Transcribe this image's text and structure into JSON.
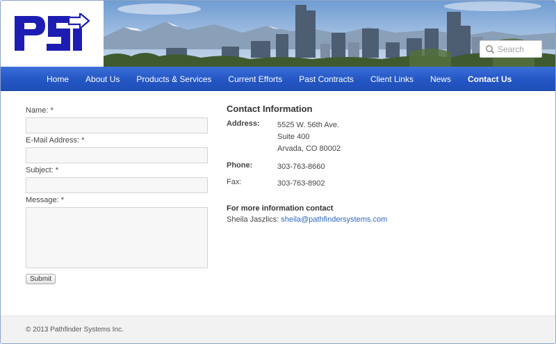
{
  "logo": {
    "text": "PSI",
    "color": "#1d1db3"
  },
  "search": {
    "placeholder": "Search",
    "icon": "search-icon"
  },
  "nav": {
    "items": [
      {
        "label": "Home",
        "active": false
      },
      {
        "label": "About Us",
        "active": false
      },
      {
        "label": "Products & Services",
        "active": false
      },
      {
        "label": "Current Efforts",
        "active": false
      },
      {
        "label": "Past Contracts",
        "active": false
      },
      {
        "label": "Client Links",
        "active": false
      },
      {
        "label": "News",
        "active": false
      },
      {
        "label": "Contact Us",
        "active": true
      }
    ],
    "color": "#2456c4"
  },
  "form": {
    "name_label": "Name: *",
    "email_label": "E-Mail Address: *",
    "subject_label": "Subject: *",
    "message_label": "Message: *",
    "name_value": "",
    "email_value": "",
    "subject_value": "",
    "message_value": "",
    "submit_label": "Submit"
  },
  "contact_info": {
    "title": "Contact Information",
    "address_label": "Address:",
    "address_line1": "5525 W. 56th Ave.",
    "address_line2": "Suite 400",
    "address_line3": "Arvada, CO 80002",
    "phone_label": "Phone:",
    "phone_value": "303-763-8660",
    "fax_label": "Fax:",
    "fax_value": "303-763-8902",
    "more_info_title": "For more information contact",
    "contact_name": "Sheila Jaszlics:",
    "contact_email": "sheila@pathfindersystems.com",
    "link_color": "#2d66c4"
  },
  "footer": {
    "copyright": "© 2013 Pathfinder Systems Inc."
  }
}
